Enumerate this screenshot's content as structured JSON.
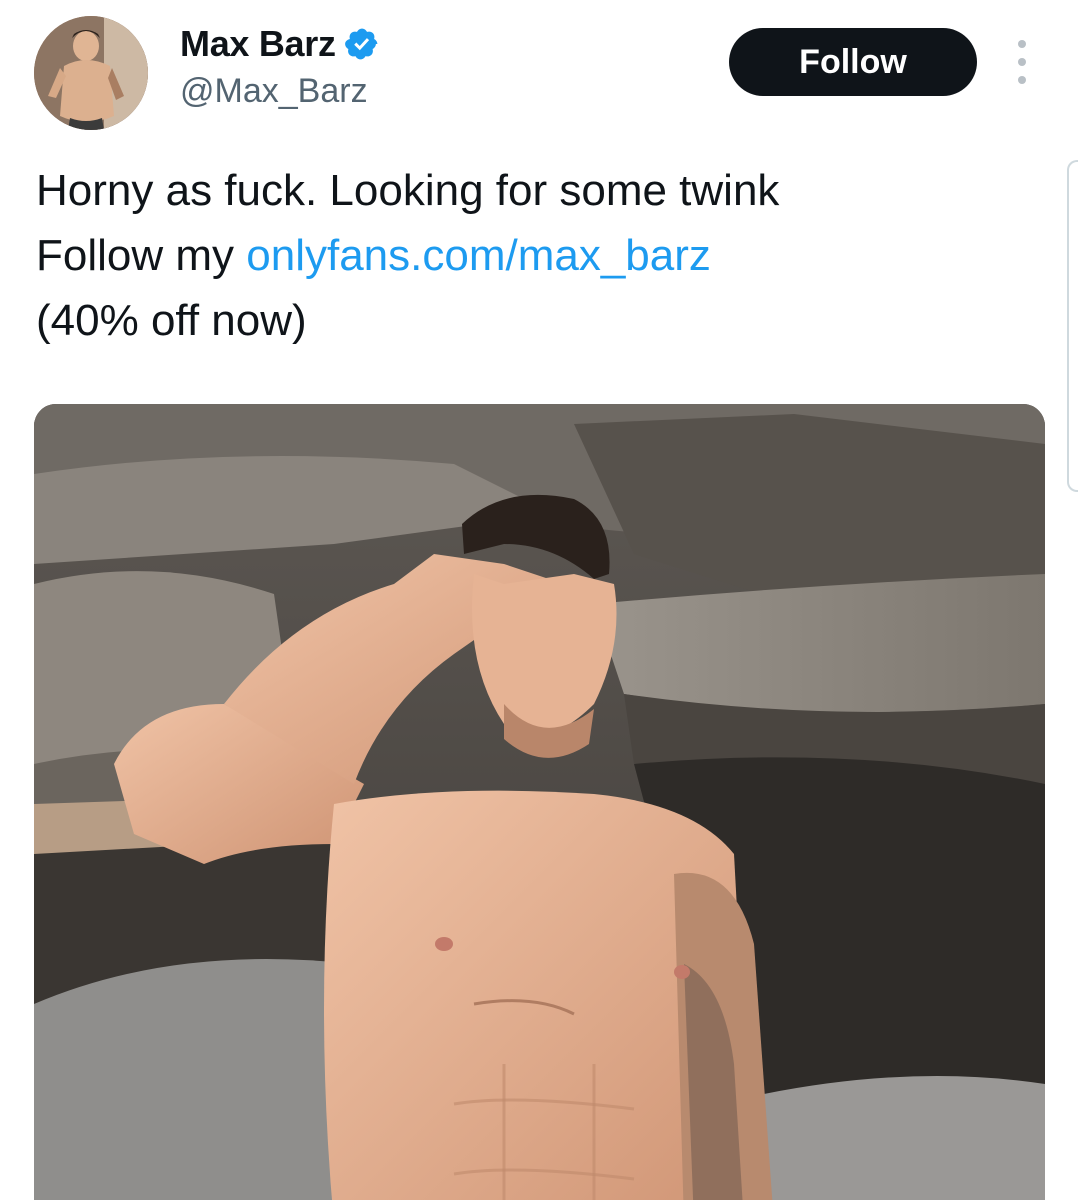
{
  "tweet": {
    "author": {
      "display_name": "Max Barz",
      "handle": "@Max_Barz",
      "verified": true
    },
    "follow_label": "Follow",
    "text_lines": {
      "line1": "Horny as fuck. Looking for some twink",
      "line2_prefix": "Follow my ",
      "line2_link": "onlyfans.com/max_barz",
      "line3": "(40% off now)"
    },
    "media": {
      "icon": "photo"
    }
  },
  "colors": {
    "link": "#1d9bf0",
    "verified": "#1d9bf0",
    "follow_bg": "#0f1419",
    "handle": "#536471"
  }
}
